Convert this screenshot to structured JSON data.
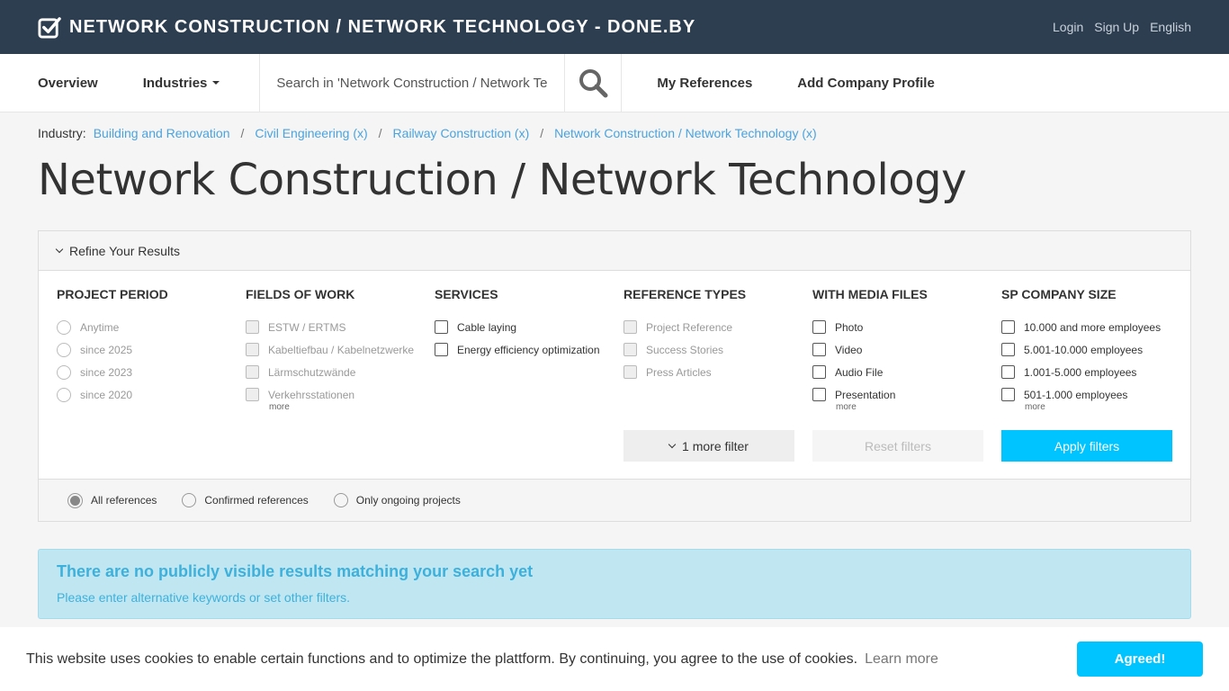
{
  "header": {
    "brand": "NETWORK CONSTRUCTION / NETWORK TECHNOLOGY - DONE.BY",
    "links": [
      "Login",
      "Sign Up",
      "English"
    ]
  },
  "nav": {
    "overview": "Overview",
    "industries": "Industries",
    "search_placeholder": "Search in 'Network Construction / Network Technology'",
    "my_references": "My References",
    "add_company": "Add Company Profile"
  },
  "breadcrumb": {
    "label": "Industry:",
    "items": [
      "Building and Renovation",
      "Civil Engineering (x)",
      "Railway Construction (x)",
      "Network Construction / Network Technology (x)"
    ],
    "separator": "/"
  },
  "page_title": "Network Construction / Network Technology",
  "filters": {
    "heading": "Refine Your Results",
    "columns": [
      {
        "title": "PROJECT PERIOD",
        "options": [
          "Anytime",
          "since 2025",
          "since 2023",
          "since 2020"
        ],
        "more": ""
      },
      {
        "title": "FIELDS OF WORK",
        "options": [
          "ESTW / ERTMS",
          "Kabeltiefbau / Kabelnetzwerke",
          "Lärmschutzwände",
          "Verkehrsstationen"
        ],
        "more": "more"
      },
      {
        "title": "SERVICES",
        "options": [
          "Cable laying",
          "Energy efficiency optimization"
        ],
        "more": ""
      },
      {
        "title": "REFERENCE TYPES",
        "options": [
          "Project Reference",
          "Success Stories",
          "Press Articles"
        ],
        "more": ""
      },
      {
        "title": "WITH MEDIA FILES",
        "options": [
          "Photo",
          "Video",
          "Audio File",
          "Presentation"
        ],
        "more": "more"
      },
      {
        "title": "SP COMPANY SIZE",
        "options": [
          "10.000 and more employees",
          "5.001-10.000 employees",
          "1.001-5.000 employees",
          "501-1.000 employees"
        ],
        "more": "more"
      }
    ],
    "more_filter": "1 more filter",
    "reset": "Reset filters",
    "apply": "Apply filters",
    "scope": [
      "All references",
      "Confirmed references",
      "Only ongoing projects"
    ]
  },
  "alert": {
    "title": "There are no publicly visible results matching your search yet",
    "text": "Please enter alternative keywords or set other filters."
  },
  "cookie": {
    "text": "This website uses cookies to enable certain functions and to optimize the plattform. By continuing, you agree to the use of cookies.",
    "learn": "Learn more",
    "agree": "Agreed!"
  },
  "colors": {
    "topbar": "#2d3e50",
    "accent": "#00c4ff",
    "link": "#4aa3df",
    "alert_bg": "#c0e6f1"
  }
}
